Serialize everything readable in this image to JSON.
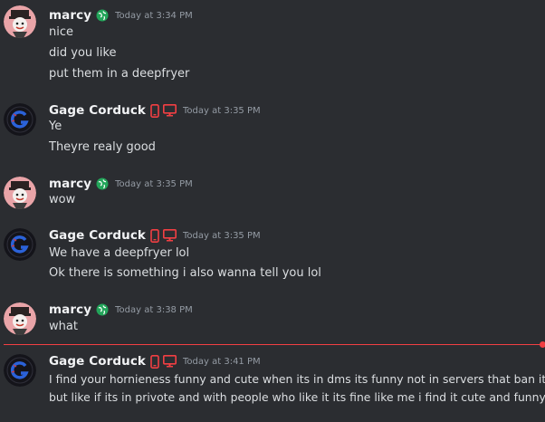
{
  "colors": {
    "background": "#2b2d31",
    "username": "#f2f3f5",
    "message_text": "#dbdee1",
    "timestamp": "#949ba4",
    "new_message_divider": "#f23f43",
    "globe_badge": "#23a55a",
    "device_badge": "#f23f43"
  },
  "messages": [
    {
      "author": "marcy",
      "badge": "globe-icon",
      "timestamp": "Today at 3:34 PM",
      "lines": [
        "nice",
        "did you like",
        "put them in a deepfryer"
      ]
    },
    {
      "author": "Gage Corduck",
      "badge": "mobile-desktop-icons",
      "timestamp": "Today at 3:35 PM",
      "lines": [
        "Ye",
        "Theyre realy good"
      ]
    },
    {
      "author": "marcy",
      "badge": "globe-icon",
      "timestamp": "Today at 3:35 PM",
      "lines": [
        "wow"
      ]
    },
    {
      "author": "Gage Corduck",
      "badge": "mobile-desktop-icons",
      "timestamp": "Today at 3:35 PM",
      "lines": [
        "We have a deepfryer lol",
        "Ok there is something i also wanna tell you lol"
      ]
    },
    {
      "author": "marcy",
      "badge": "globe-icon",
      "timestamp": "Today at 3:38 PM",
      "lines": [
        "what"
      ]
    },
    {
      "author": "Gage Corduck",
      "badge": "mobile-desktop-icons",
      "timestamp": "Today at 3:41 PM",
      "lines": [
        "I find your hornieness funny and  cute when its in dms its funny not in servers that ban it",
        "but like if its in privote and with people who like it its fine like me i find it cute and funny"
      ]
    }
  ]
}
